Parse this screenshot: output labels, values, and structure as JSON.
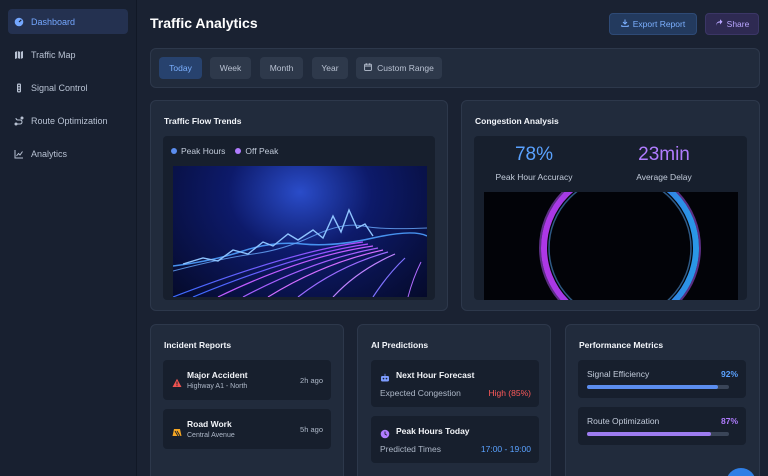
{
  "sidebar": {
    "items": [
      {
        "label": "Dashboard",
        "icon": "gauge-icon",
        "active": true
      },
      {
        "label": "Traffic Map",
        "icon": "map-icon"
      },
      {
        "label": "Signal Control",
        "icon": "traffic-light-icon"
      },
      {
        "label": "Route Optimization",
        "icon": "route-icon"
      },
      {
        "label": "Analytics",
        "icon": "line-chart-icon"
      }
    ]
  },
  "header": {
    "title": "Traffic Analytics",
    "export_label": "Export Report",
    "share_label": "Share"
  },
  "filters": [
    "Today",
    "Week",
    "Month",
    "Year",
    "Custom Range"
  ],
  "traffic_flow": {
    "title": "Traffic Flow Trends",
    "legend": [
      {
        "label": "Peak Hours",
        "color": "#5b8def"
      },
      {
        "label": "Off Peak",
        "color": "#b07cff"
      }
    ]
  },
  "congestion": {
    "title": "Congestion Analysis",
    "stat1_value": "78%",
    "stat1_label": "Peak Hour Accuracy",
    "stat2_value": "23min",
    "stat2_label": "Average Delay"
  },
  "incidents": {
    "title": "Incident Reports",
    "items": [
      {
        "title": "Major Accident",
        "location": "Highway A1 - North",
        "time": "2h ago",
        "icon": "warning-icon",
        "color": "#ef5350"
      },
      {
        "title": "Road Work",
        "location": "Central Avenue",
        "time": "5h ago",
        "icon": "construction-icon",
        "color": "#f5a623"
      }
    ]
  },
  "predictions": {
    "title": "AI Predictions",
    "items": [
      {
        "title": "Next Hour Forecast",
        "label": "Expected Congestion",
        "value": "High (85%)",
        "value_color": "#ff5a5a",
        "icon": "robot-icon"
      },
      {
        "title": "Peak Hours Today",
        "label": "Predicted Times",
        "value": "17:00 - 19:00",
        "value_color": "#5aa2ff",
        "icon": "clock-icon"
      }
    ]
  },
  "performance": {
    "title": "Performance Metrics",
    "items": [
      {
        "label": "Signal Efficiency",
        "value": "92%",
        "fraction": 0.92,
        "color": "#5b8def"
      },
      {
        "label": "Route Optimization",
        "value": "87%",
        "fraction": 0.87,
        "color": "#9d7cf0"
      }
    ]
  },
  "colors": {
    "accent_blue": "#5aa2ff",
    "accent_purple": "#b07cff"
  }
}
